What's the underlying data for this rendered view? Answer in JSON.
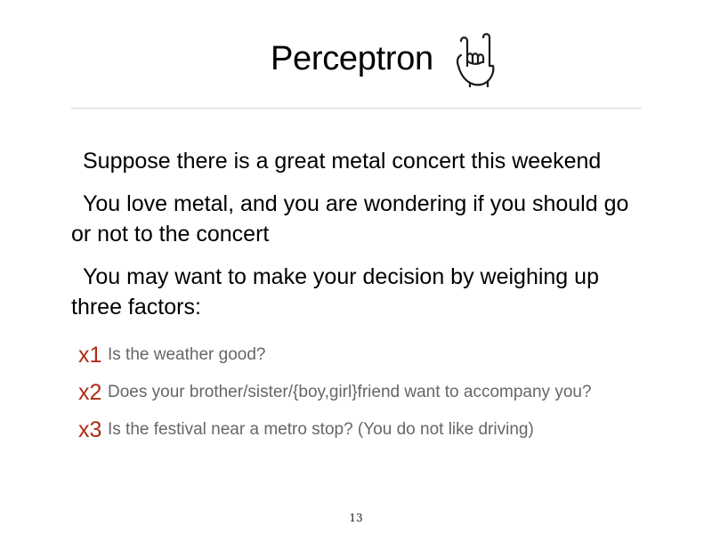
{
  "slide": {
    "title": "Perceptron",
    "title_icon": "rock-on-hand-icon",
    "paragraphs": [
      "Suppose there is a great metal concert this weekend",
      "You love metal, and you are wondering if you should go or not to the concert",
      "You may want to make your decision by weighing up three factors:"
    ],
    "factors": [
      {
        "id": "x1",
        "text": "Is the weather good?"
      },
      {
        "id": "x2",
        "text": "Does your brother/sister/{boy,girl}friend want to accompany you?"
      },
      {
        "id": "x3",
        "text": "Is the festival near a metro stop? (You do not like driving)"
      }
    ],
    "page_number": "13"
  },
  "colors": {
    "factor_id": "#b02a17",
    "factor_text": "#666666",
    "divider": "#d9d9d9"
  }
}
